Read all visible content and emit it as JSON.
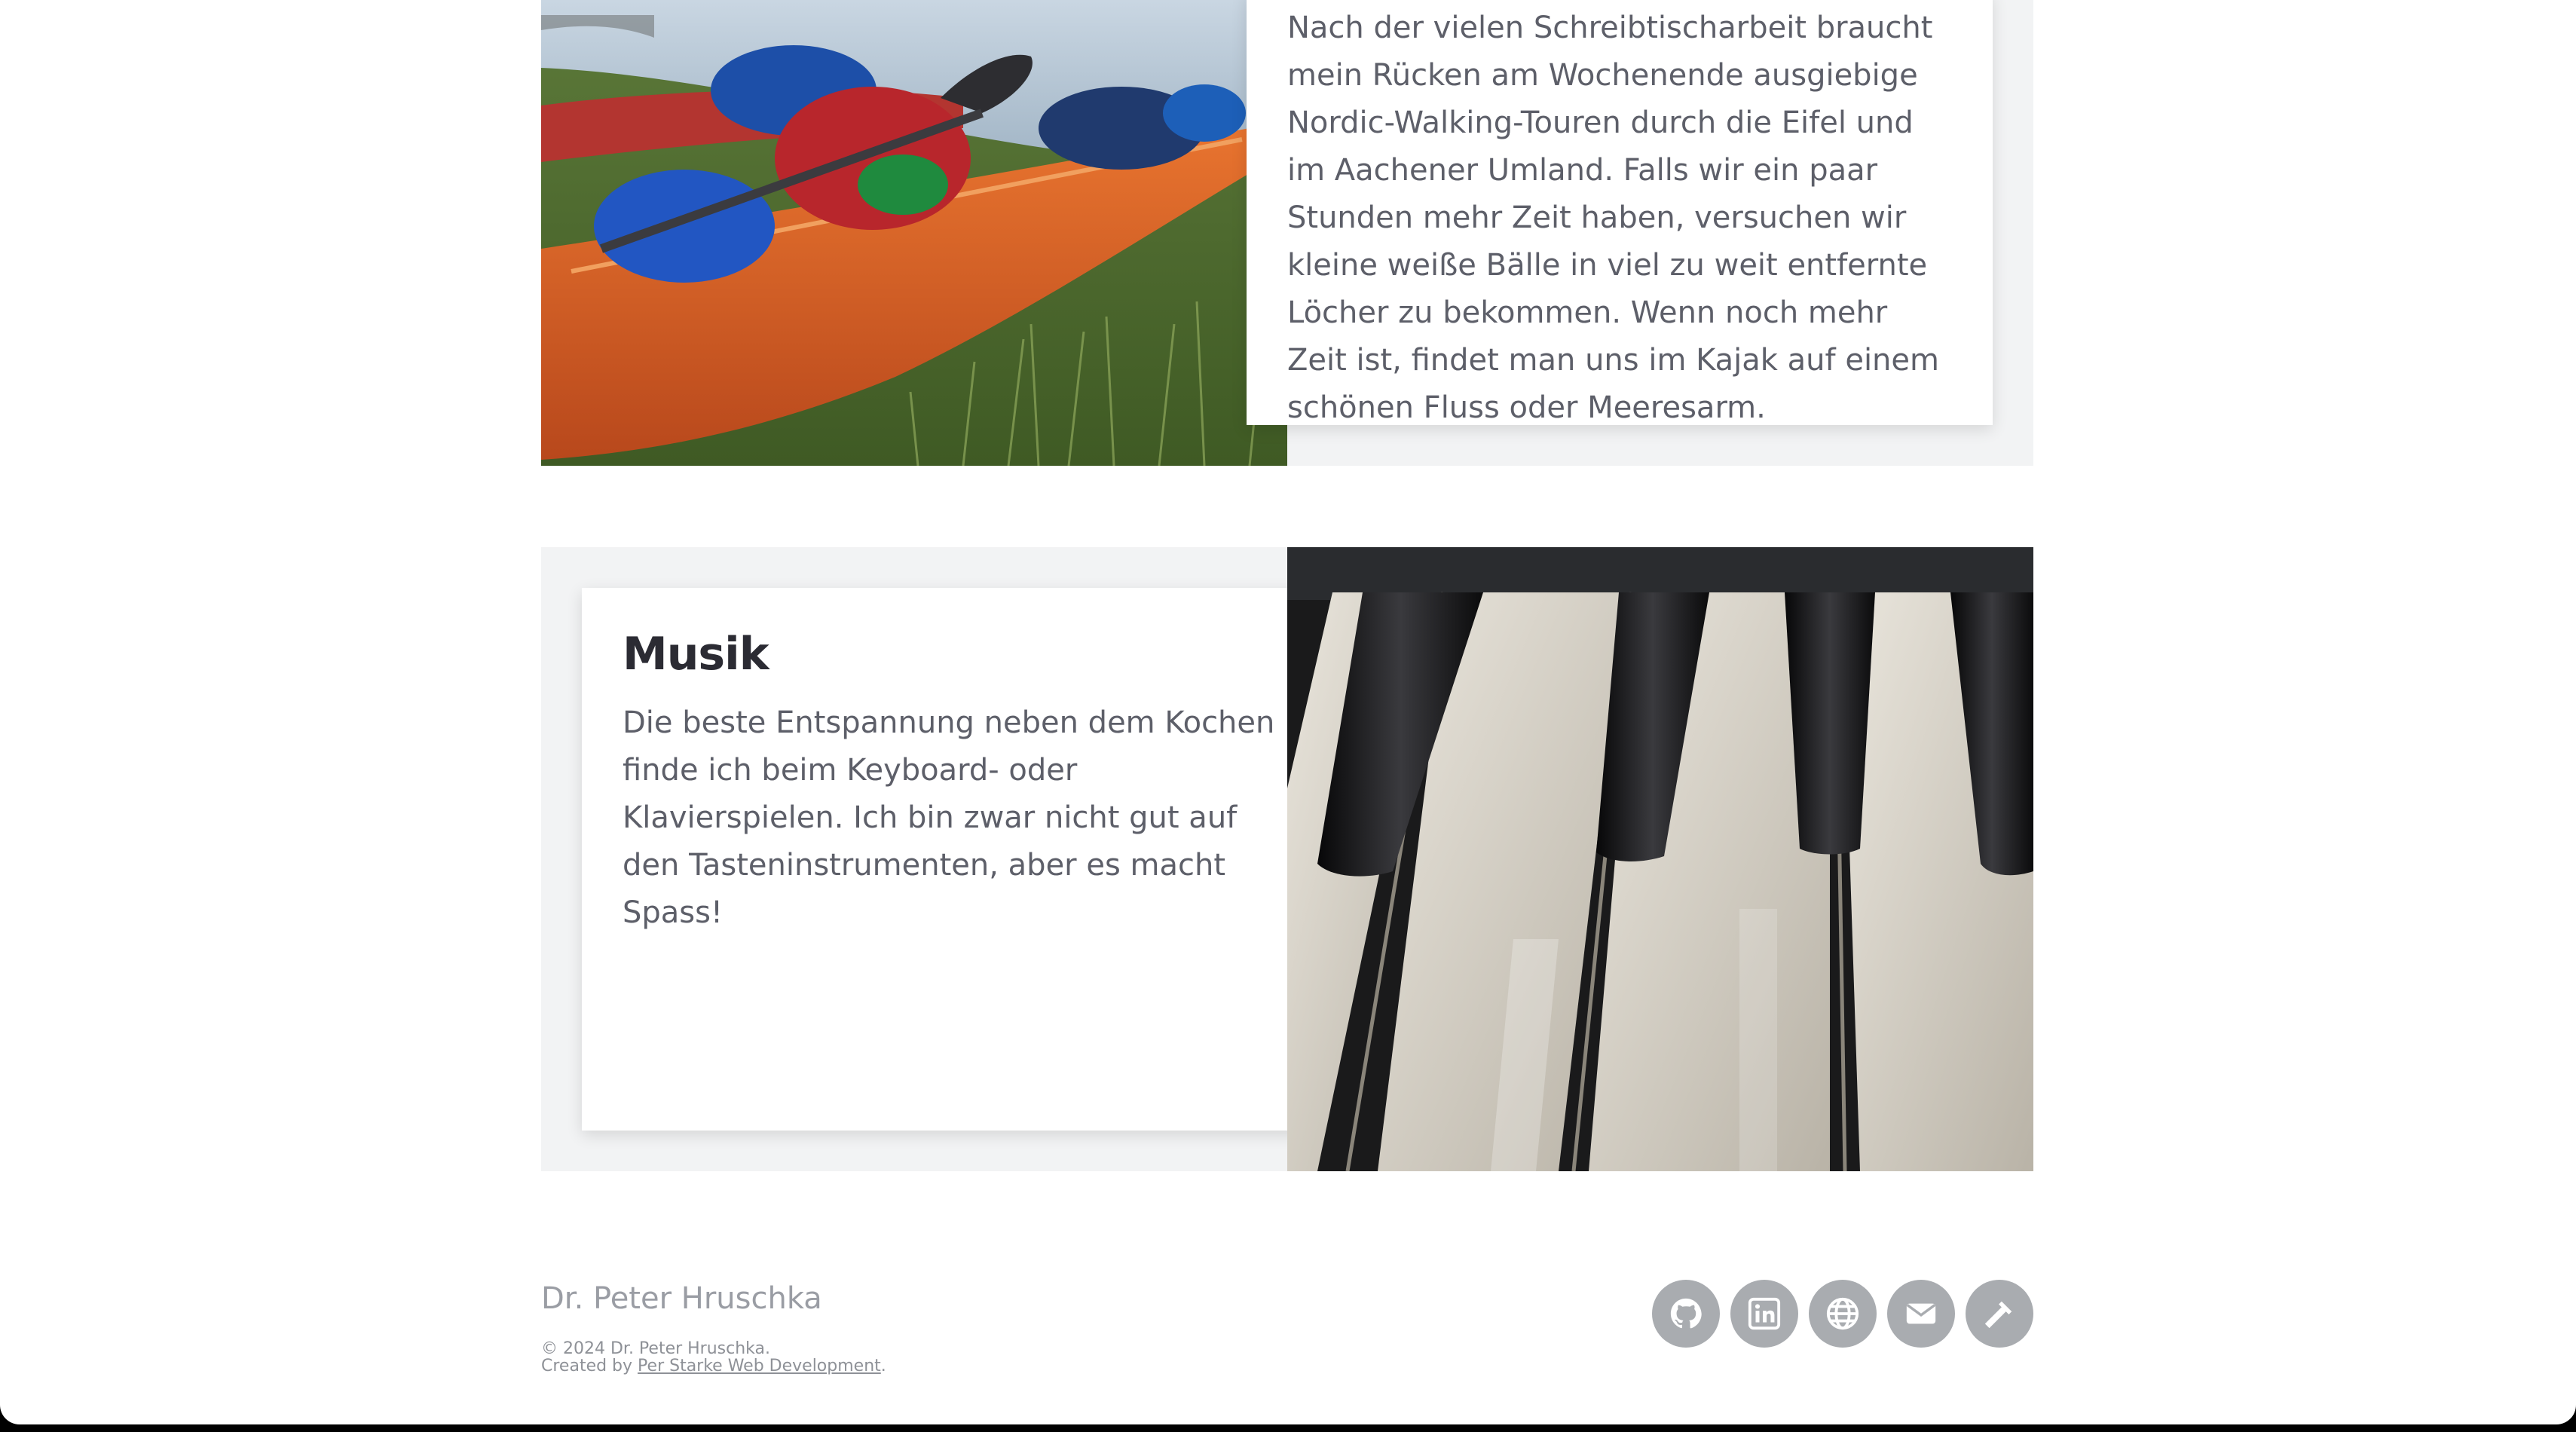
{
  "sections": {
    "sport": {
      "text": "Nach der vielen Schreibtischarbeit braucht mein Rücken am Wochenende ausgiebige Nordic-Walking-Touren durch die Eifel und im Aachener Umland. Falls wir ein paar Stunden mehr Zeit haben, versuchen wir kleine weiße Bälle in viel zu weit entfernte Löcher zu bekommen. Wenn noch mehr Zeit ist, findet man uns im Kajak auf einem schönen Fluss oder Meeresarm."
    },
    "music": {
      "heading": "Musik",
      "text": "Die beste Entspannung neben dem Kochen finde ich beim Keyboard- oder Klavierspielen. Ich bin zwar nicht gut auf den Tasteninstrumenten, aber es macht Spass!"
    }
  },
  "footer": {
    "name": "Dr. Peter Hruschka",
    "copyright": "© 2024 Dr. Peter Hruschka.",
    "created_by_prefix": "Created by ",
    "created_by_link": "Per Starke Web Development",
    "created_by_suffix": ".",
    "social_icons": [
      "github-icon",
      "linkedin-icon",
      "globe-icon",
      "envelope-icon",
      "hammer-icon"
    ]
  },
  "colors": {
    "section_background": "#f2f3f4",
    "heading": "#2b2b33",
    "body_text": "#5d5f69",
    "footer_text": "#9a9da4",
    "social_button": "#a9acb0"
  }
}
